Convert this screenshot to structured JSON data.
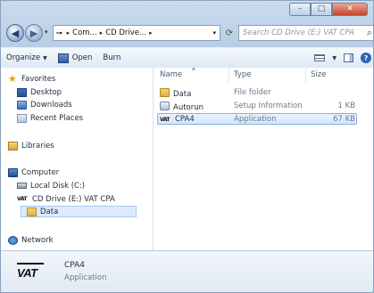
{
  "window": {
    "caption": {
      "min": "–",
      "max": "□",
      "close": "✕"
    }
  },
  "nav": {
    "back_glyph": "◀",
    "forward_glyph": "▶",
    "address": [
      "Com...",
      "CD Drive...",
      ""
    ],
    "address_dropdown": "▾",
    "refresh_glyph": "⟳",
    "search_placeholder": "Search CD Drive (E:) VAT CPA"
  },
  "toolbar": {
    "organize": "Organize",
    "open": "Open",
    "burn": "Burn"
  },
  "sidebar": {
    "favorites": "Favorites",
    "desktop": "Desktop",
    "downloads": "Downloads",
    "recent": "Recent Places",
    "libraries": "Libraries",
    "computer": "Computer",
    "local_disk": "Local Disk (C:)",
    "cd_drive": "CD Drive (E:) VAT CPA",
    "data_folder": "Data",
    "network": "Network"
  },
  "columns": {
    "name": "Name",
    "type": "Type",
    "size": "Size"
  },
  "files": [
    {
      "name": "Data",
      "type": "File folder",
      "size": "",
      "icon": "folder-icon"
    },
    {
      "name": "Autorun",
      "type": "Setup Information",
      "size": "1 KB",
      "icon": "autorun-icon"
    },
    {
      "name": "CPA4",
      "type": "Application",
      "size": "67 KB",
      "icon": "application-icon"
    }
  ],
  "details": {
    "logo_text": "VAT",
    "name": "CPA4",
    "type": "Application"
  },
  "colors": {
    "accent": "#2d64b3",
    "selection": "#d5e6fb"
  }
}
